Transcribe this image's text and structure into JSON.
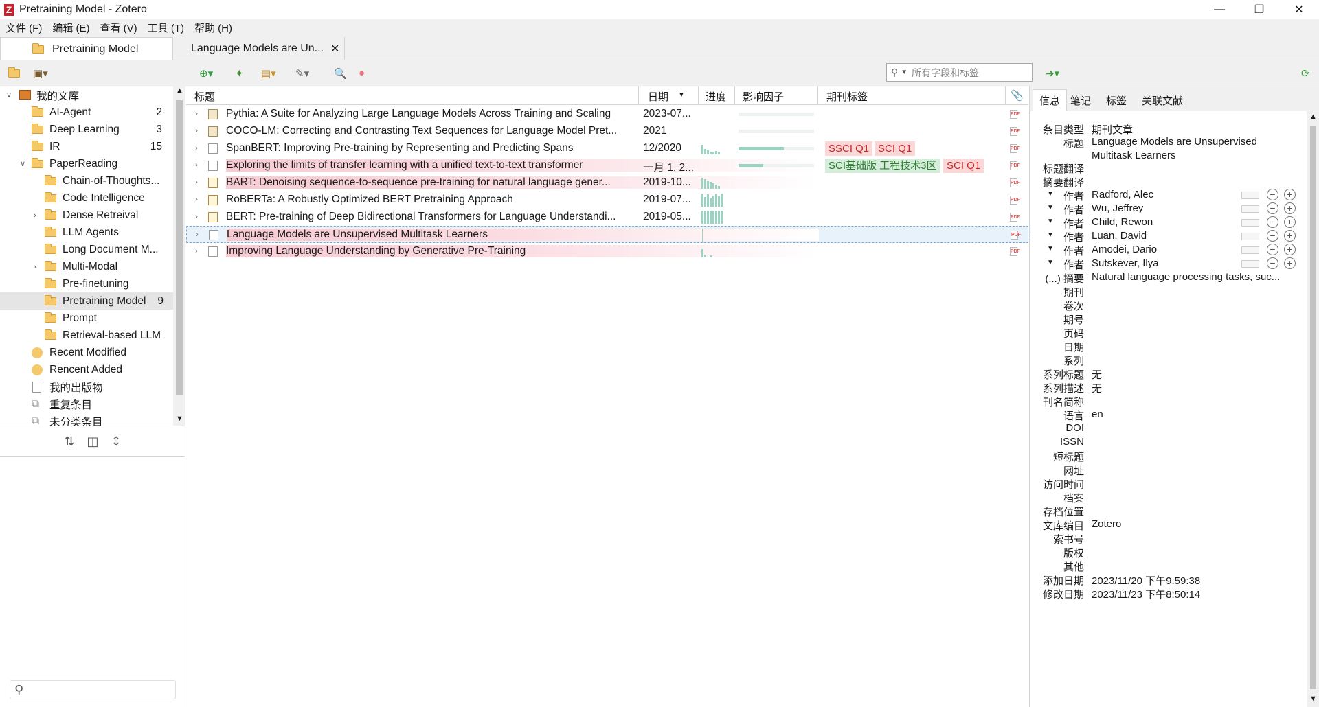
{
  "window": {
    "title": "Pretraining Model - Zotero",
    "logo_letter": "Z"
  },
  "menu": [
    "文件 (F)",
    "编辑 (E)",
    "查看 (V)",
    "工具 (T)",
    "帮助 (H)"
  ],
  "tabs": [
    {
      "label": "Pretraining Model"
    },
    {
      "label": "Language Models are Un...",
      "close": "✕"
    }
  ],
  "search": {
    "placeholder": "所有字段和标签"
  },
  "collections": [
    {
      "label": "我的文库",
      "count": "",
      "icon": "library-icon"
    },
    {
      "label": "AI-Agent",
      "count": "2"
    },
    {
      "label": "Deep Learning",
      "count": "3"
    },
    {
      "label": "IR",
      "count": "15"
    },
    {
      "label": "PaperReading",
      "count": ""
    },
    {
      "label": "Chain-of-Thoughts...",
      "count": ""
    },
    {
      "label": "Code Intelligence",
      "count": ""
    },
    {
      "label": "Dense Retreival",
      "count": ""
    },
    {
      "label": "LLM Agents",
      "count": ""
    },
    {
      "label": "Long Document M...",
      "count": ""
    },
    {
      "label": "Multi-Modal",
      "count": ""
    },
    {
      "label": "Pre-finetuning",
      "count": ""
    },
    {
      "label": "Pretraining Model",
      "count": "9"
    },
    {
      "label": "Prompt",
      "count": ""
    },
    {
      "label": "Retrieval-based LLM",
      "count": ""
    },
    {
      "label": "Recent Modified",
      "count": ""
    },
    {
      "label": "Rencent Added",
      "count": ""
    },
    {
      "label": "我的出版物",
      "count": ""
    },
    {
      "label": "重复条目",
      "count": ""
    },
    {
      "label": "未分类条目",
      "count": ""
    }
  ],
  "columns": {
    "title": "标题",
    "date": "日期",
    "progress": "进度",
    "impact": "影响因子",
    "journal_tags": "期刊标签"
  },
  "items": [
    {
      "title": "Pythia: A Suite for Analyzing Large Language Models Across Training and Scaling",
      "date": "2023-07...",
      "progress": 0,
      "tags": []
    },
    {
      "title": "COCO-LM: Correcting and Contrasting Text Sequences for Language Model Pret...",
      "date": "2021",
      "progress": 0,
      "tags": []
    },
    {
      "title": "SpanBERT: Improving Pre-training by Representing and Predicting Spans",
      "date": "12/2020",
      "progress": 0.6,
      "tags": [
        {
          "text": "SSCI Q1",
          "kind": "r"
        },
        {
          "text": "SCI Q1",
          "kind": "r"
        }
      ]
    },
    {
      "title": "Exploring the limits of transfer learning with a unified text-to-text transformer",
      "date": "一月 1, 2...",
      "progress": 0.33,
      "tags": [
        {
          "text": "SCI基础版 工程技术3区",
          "kind": "g"
        },
        {
          "text": "SCI Q1",
          "kind": "r"
        }
      ]
    },
    {
      "title": "BART: Denoising sequence-to-sequence pre-training for natural language gener...",
      "date": "2019-10...",
      "progress": 0,
      "tags": []
    },
    {
      "title": "RoBERTa: A Robustly Optimized BERT Pretraining Approach",
      "date": "2019-07...",
      "progress": 0,
      "tags": []
    },
    {
      "title": "BERT: Pre-training of Deep Bidirectional Transformers for Language Understandi...",
      "date": "2019-05...",
      "progress": 0,
      "tags": []
    },
    {
      "title": "Language Models are Unsupervised Multitask Learners",
      "date": "",
      "progress": 0,
      "tags": []
    },
    {
      "title": "Improving Language Understanding by Generative Pre-Training",
      "date": "",
      "progress": 0,
      "tags": []
    }
  ],
  "pane_tabs": [
    "信息",
    "笔记",
    "标签",
    "关联文献"
  ],
  "info": {
    "item_type_label": "条目类型",
    "item_type": "期刊文章",
    "title_label": "标题",
    "title_line1": "Language Models are Unsupervised",
    "title_line2": "Multitask Learners",
    "title_trans_label": "标题翻译",
    "abstract_trans_label": "摘要翻译",
    "author_label": "作者",
    "authors": [
      "Radford, Alec",
      "Wu, Jeffrey",
      "Child, Rewon",
      "Luan, David",
      "Amodei, Dario",
      "Sutskever, Ilya"
    ],
    "abstract_label": "(...) 摘要",
    "abstract": "Natural language processing tasks, suc...",
    "fields": [
      {
        "label": "期刊",
        "value": ""
      },
      {
        "label": "卷次",
        "value": ""
      },
      {
        "label": "期号",
        "value": ""
      },
      {
        "label": "页码",
        "value": ""
      },
      {
        "label": "日期",
        "value": ""
      },
      {
        "label": "系列",
        "value": ""
      },
      {
        "label": "系列标题",
        "value": "无"
      },
      {
        "label": "系列描述",
        "value": "无"
      },
      {
        "label": "刊名简称",
        "value": ""
      },
      {
        "label": "语言",
        "value": "en"
      },
      {
        "label": "DOI",
        "value": ""
      },
      {
        "label": "ISSN",
        "value": ""
      },
      {
        "label": "短标题",
        "value": ""
      },
      {
        "label": "网址",
        "value": ""
      },
      {
        "label": "访问时间",
        "value": ""
      },
      {
        "label": "档案",
        "value": ""
      },
      {
        "label": "存档位置",
        "value": ""
      },
      {
        "label": "文库编目",
        "value": "Zotero"
      },
      {
        "label": "索书号",
        "value": ""
      },
      {
        "label": "版权",
        "value": ""
      },
      {
        "label": "其他",
        "value": ""
      },
      {
        "label": "添加日期",
        "value": "2023/11/20 下午9:59:38"
      },
      {
        "label": "修改日期",
        "value": "2023/11/23 下午8:50:14"
      }
    ]
  }
}
